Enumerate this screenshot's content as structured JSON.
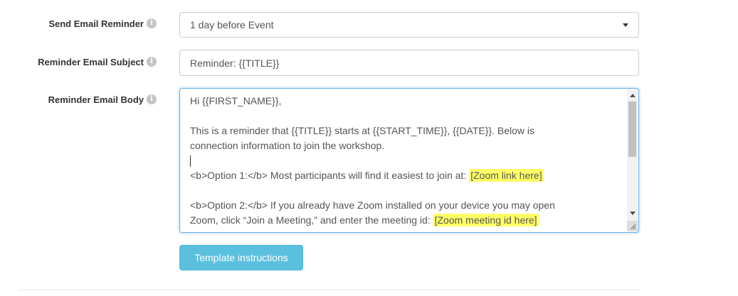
{
  "fields": {
    "send_reminder": {
      "label": "Send Email Reminder",
      "selected": "1 day before Event"
    },
    "subject": {
      "label": "Reminder Email Subject",
      "value": "Reminder: {{TITLE}}"
    },
    "body": {
      "label": "Reminder Email Body",
      "lines": {
        "l1": "Hi {{FIRST_NAME}},",
        "l3": "This is a reminder that {{TITLE}} starts at {{START_TIME}}, {{DATE}}. Below is",
        "l4": "connection information to join the workshop.",
        "l6_text": "<b>Option 1:</b> Most participants will find it easiest to join at: ",
        "l6_highlight": "[Zoom link here]",
        "l8": "<b>Option 2:</b> If you already have Zoom installed on your device you may open",
        "l9_text": "Zoom, click “Join a Meeting,” and enter the meeting id: ",
        "l9_highlight": "[Zoom meeting id here]"
      }
    }
  },
  "info_icon_glyph": "i",
  "buttons": {
    "template_instructions": "Template instructions"
  },
  "colors": {
    "button_bg": "#5bc0de",
    "highlight": "#ffff66",
    "focus_border": "#66afe9"
  }
}
